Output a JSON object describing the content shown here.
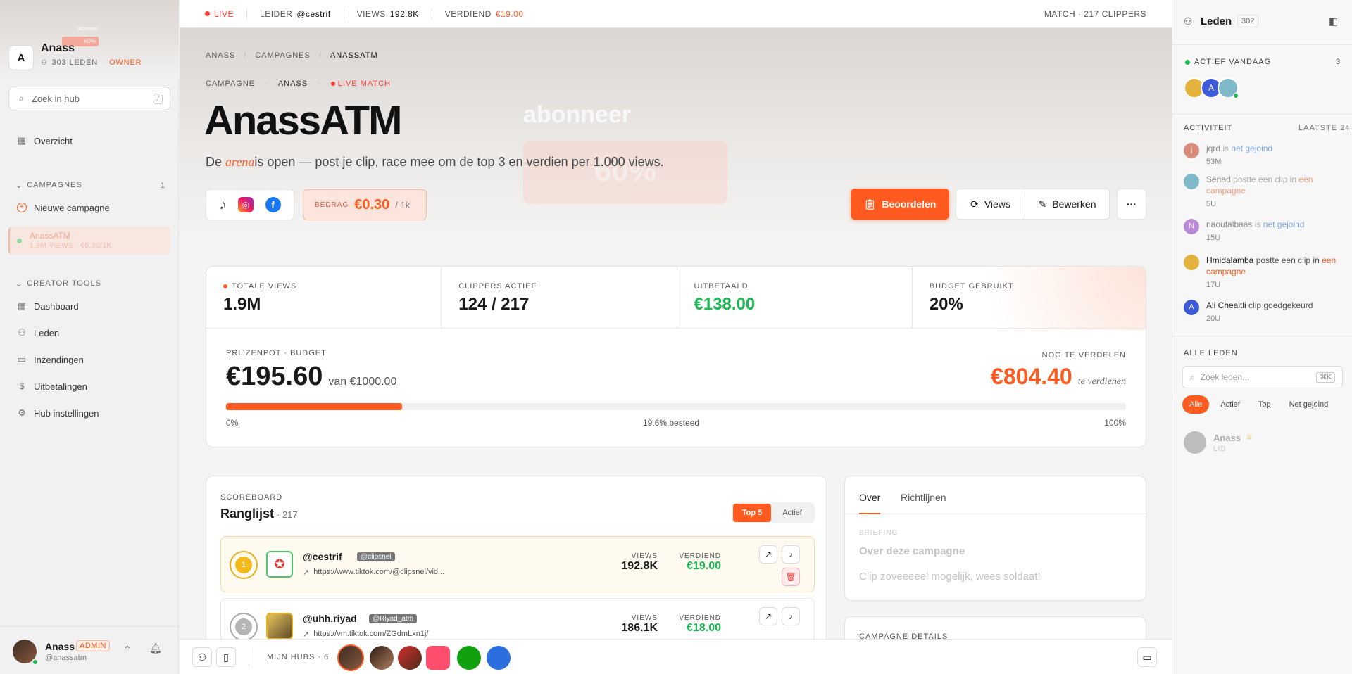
{
  "sidebar": {
    "hub_name": "Anass",
    "hub_initial": "A",
    "members": "303 LEDEN",
    "role": "OWNER",
    "banner_text": "abonneer",
    "banner_pct": "60%",
    "search_placeholder": "Zoek in hub",
    "search_kbd": "/",
    "overview": "Overzicht",
    "campaigns_label": "CAMPAGNES",
    "campaigns_count": "1",
    "new_campaign": "Nieuwe campagne",
    "campaign_item": {
      "name": "AnassATM",
      "meta": "1.9M VIEWS · €0.30/1K"
    },
    "creator_tools_label": "CREATOR TOOLS",
    "tools": [
      "Dashboard",
      "Leden",
      "Inzendingen",
      "Uitbetalingen",
      "Hub instellingen"
    ],
    "user": {
      "name": "Anass",
      "badge": "ADMIN",
      "handle": "@anassatm"
    }
  },
  "topbar": {
    "live": "LIVE",
    "leader_label": "LEIDER",
    "leader": "@cestrif",
    "views_label": "VIEWS",
    "views": "192.8K",
    "earned_label": "VERDIEND",
    "earned": "€19.00",
    "match": "MATCH · 217 CLIPPERS"
  },
  "breadcrumb": [
    "ANASS",
    "CAMPAGNES",
    "ANASSATM"
  ],
  "meta": {
    "campaign": "CAMPAGNE",
    "hub": "ANASS",
    "live_match": "LIVE MATCH"
  },
  "title": "AnassATM",
  "subtitle_pre": "De ",
  "subtitle_em": "arena",
  "subtitle_post": "is open — post je clip, race mee om de top 3 en verdien per 1.000 views.",
  "hero_overlay": {
    "text": "abonneer",
    "pct": "60%"
  },
  "rate": {
    "label": "BEDRAG",
    "value": "€0.30",
    "unit": "/ 1k"
  },
  "actions": {
    "review": "Beoordelen",
    "views": "Views",
    "edit": "Bewerken",
    "more": "···"
  },
  "stats": [
    {
      "label": "TOTALE VIEWS",
      "value": "1.9M"
    },
    {
      "label": "CLIPPERS ACTIEF",
      "value": "124 / 217"
    },
    {
      "label": "UITBETAALD",
      "value": "€138.00"
    },
    {
      "label": "BUDGET GEBRUIKT",
      "value": "20%"
    }
  ],
  "prize": {
    "label": "PRIJZENPOT · BUDGET",
    "value": "€195.60",
    "of": "van €1000.00",
    "remaining_label": "NOG TE VERDELEN",
    "remaining": "€804.40",
    "remaining_note": "te verdienen",
    "progress": 0.196,
    "min": "0%",
    "mid": "19.6% besteed",
    "max": "100%"
  },
  "scoreboard": {
    "label": "SCOREBOARD",
    "title": "Ranglijst",
    "count": "· 217",
    "tab_top": "Top 5",
    "tab_active": "Actief",
    "rows": [
      {
        "name": "@cestrif",
        "tag": "@clipsnel",
        "url": "https://www.tiktok.com/@clipsnel/vid...",
        "views_label": "VIEWS",
        "views": "192.8K",
        "earned_label": "VERDIEND",
        "earned": "€19.00"
      },
      {
        "name": "@uhh.riyad",
        "tag": "@Riyad_atm",
        "url": "https://vm.tiktok.com/ZGdmLxn1j/",
        "views_label": "VIEWS",
        "views": "186.1K",
        "earned_label": "VERDIEND",
        "earned": "€18.00"
      }
    ]
  },
  "about": {
    "tab_over": "Over",
    "tab_rules": "Richtlijnen",
    "briefing": "BRIEFING",
    "heading": "Over deze campagne",
    "text": "Clip zoveeeeel mogelijk, wees soldaat!",
    "details": "CAMPAGNE DETAILS"
  },
  "bottombar": {
    "hubs_label": "MIJN HUBS · 6"
  },
  "right": {
    "title": "Leden",
    "count": "302",
    "active_label": "ACTIEF VANDAAG",
    "active_count": "3",
    "activity_label": "ACTIVITEIT",
    "activity_range": "LAATSTE 24",
    "activity": [
      {
        "user": "jqrd",
        "verb": " is ",
        "link": "net gejoind",
        "time": "53M",
        "color": "#d98c7a",
        "initial": "j"
      },
      {
        "user": "Senad",
        "verb": " postte een clip in ",
        "link": "een campagne",
        "time": "5U",
        "color": "#7fb8c9",
        "initial": ""
      },
      {
        "user": "naoufalbaas",
        "verb": " is ",
        "link": "net gejoind",
        "time": "15U",
        "color": "#b98ad6",
        "initial": "N"
      },
      {
        "user": "Hmidalamba",
        "verb": " postte een clip in ",
        "link": "een campagne",
        "time": "17U",
        "color": "#e3b23c",
        "initial": ""
      },
      {
        "user": "Ali Cheaitli",
        "verb": " clip goedgekeurd",
        "link": "",
        "time": "20U",
        "color": "#3d5bd6",
        "initial": "A"
      }
    ],
    "all_label": "ALLE LEDEN",
    "search_placeholder": "Zoek leden...",
    "search_kbd": "⌘K",
    "filters": [
      "Alle",
      "Actief",
      "Top",
      "Net gejoind"
    ],
    "member": {
      "name": "Anass",
      "role": "LID"
    }
  },
  "colors": {
    "accent": "#ff5a1f",
    "green": "#1db954"
  }
}
